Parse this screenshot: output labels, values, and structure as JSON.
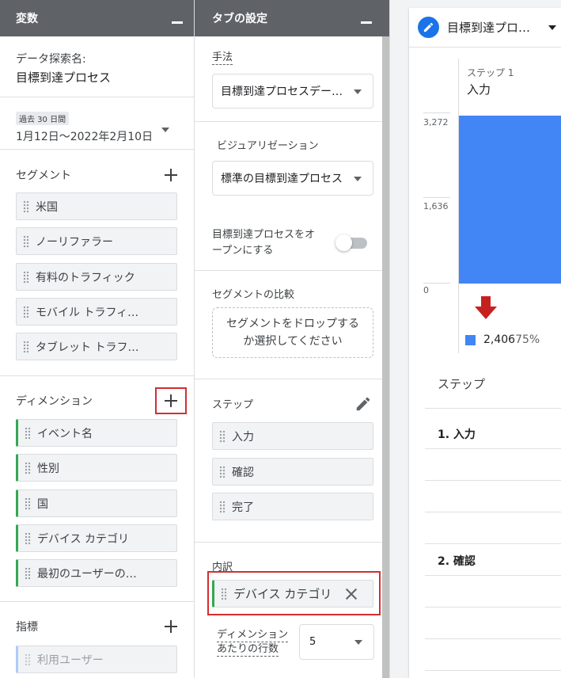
{
  "variables": {
    "title": "変数",
    "exploration_label": "データ探索名:",
    "exploration_name": "目標到達プロセス",
    "date_badge": "過去 30 日間",
    "date_range": "1月12日～2022年2月10日",
    "segments_title": "セグメント",
    "segments": [
      "米国",
      "ノーリファラー",
      "有料のトラフィック",
      "モバイル トラフィ…",
      "タブレット トラフ…"
    ],
    "dimensions_title": "ディメンション",
    "dimensions": [
      "イベント名",
      "性別",
      "国",
      "デバイス カテゴリ",
      "最初のユーザーの…"
    ],
    "metrics_title": "指標",
    "metrics": [
      "利用ユーザー"
    ]
  },
  "tab_settings": {
    "title": "タブの設定",
    "technique_label": "手法",
    "technique_value": "目標到達プロセスデー…",
    "visualization_label": "ビジュアリゼーション",
    "visualization_value": "標準の目標到達プロセス",
    "open_funnel_label_1": "目標到達プロセスをオ",
    "open_funnel_label_2": "ープンにする",
    "segment_compare_label": "セグメントの比較",
    "dropzone_line1": "セグメントをドロップする",
    "dropzone_line2": "か選択してください",
    "steps_label": "ステップ",
    "steps": [
      "入力",
      "確認",
      "完了"
    ],
    "breakdown_label": "内訳",
    "breakdown_value": "デバイス カテゴリ",
    "rows_label_1": "ディメンション",
    "rows_label_2": "あたりの行数",
    "rows_value": "5"
  },
  "canvas": {
    "tab_title": "目標到達プロ…",
    "step_number": "ステップ 1",
    "step_name": "入力",
    "y_ticks": [
      "3,272",
      "1,636",
      "0"
    ],
    "legend_value": "2,406",
    "legend_percent": "75%",
    "table_header": "ステップ",
    "rows": [
      "1. 入力",
      "2. 確認"
    ]
  },
  "chart_data": {
    "type": "bar",
    "categories": [
      "入力"
    ],
    "values": [
      3272
    ],
    "ylim": [
      0,
      3272
    ],
    "y_ticks": [
      0,
      1636,
      3272
    ],
    "abandon_value": 2406,
    "abandon_percent": 75,
    "colors": {
      "bar": "#4285f4",
      "drop_arrow": "#c5221f"
    }
  },
  "colors": {
    "accent": "#1a73e8",
    "header_bg": "#5f6368",
    "highlight": "#d32f2f",
    "dimension_chip": "#34a853",
    "metric_chip": "#aecbfa"
  }
}
